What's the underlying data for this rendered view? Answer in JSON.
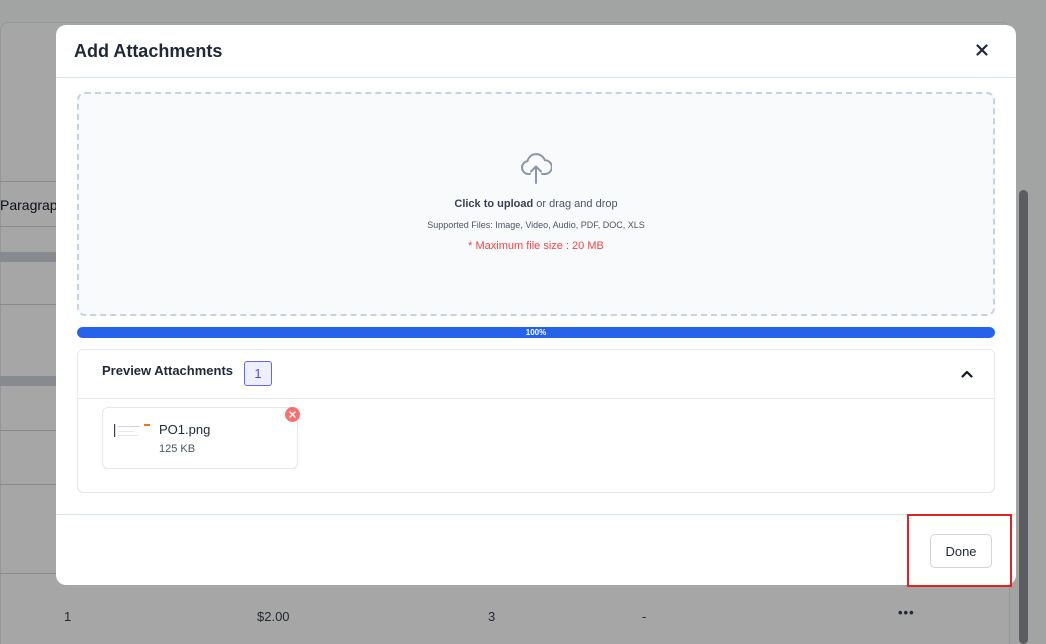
{
  "background": {
    "paragraph_text": "Paragraph",
    "row": {
      "qty": "1",
      "price": "$2.00",
      "count": "3",
      "dash": "-",
      "more": "•••"
    }
  },
  "modal": {
    "title": "Add Attachments",
    "dropzone": {
      "click_text": "Click to upload",
      "drag_text": " or drag and drop",
      "supported": "Supported Files: Image, Video, Audio, PDF, DOC, XLS",
      "max_size": "* Maximum file size : 20 MB"
    },
    "progress": {
      "value": 1.0,
      "label": "100%"
    },
    "preview": {
      "title": "Preview Attachments",
      "count": "1",
      "files": [
        {
          "name": "PO1.png",
          "size": "125 KB"
        }
      ]
    },
    "footer": {
      "done_label": "Done"
    }
  },
  "colors": {
    "accent": "#2563eb",
    "danger": "#ef4444",
    "badge": "#4f46e5",
    "highlight": "#e02424"
  }
}
